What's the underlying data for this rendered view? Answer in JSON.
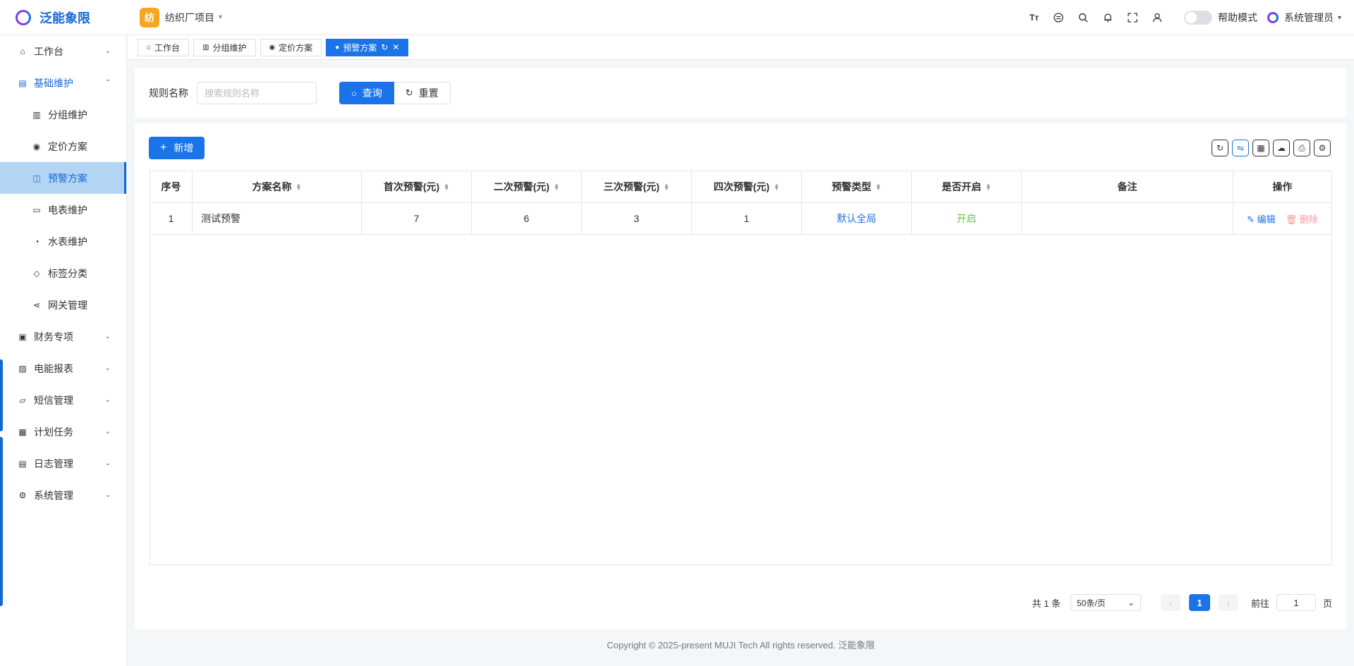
{
  "app": {
    "name": "泛能象限",
    "project_badge": "纺",
    "project_name": "纺织厂项目"
  },
  "header": {
    "font_icon_label": "Tт",
    "help_label": "帮助模式",
    "user_name": "系统管理员"
  },
  "sidebar": {
    "items": [
      {
        "label": "工作台"
      },
      {
        "label": "基础维护"
      },
      {
        "label": "分组维护"
      },
      {
        "label": "定价方案"
      },
      {
        "label": "预警方案"
      },
      {
        "label": "电表维护"
      },
      {
        "label": "水表维护"
      },
      {
        "label": "标签分类"
      },
      {
        "label": "网关管理"
      },
      {
        "label": "财务专项"
      },
      {
        "label": "电能报表"
      },
      {
        "label": "短信管理"
      },
      {
        "label": "计划任务"
      },
      {
        "label": "日志管理"
      },
      {
        "label": "系统管理"
      }
    ]
  },
  "tabs": [
    {
      "label": "工作台"
    },
    {
      "label": "分组维护"
    },
    {
      "label": "定价方案"
    },
    {
      "label": "预警方案"
    }
  ],
  "search": {
    "label": "规则名称",
    "placeholder": "搜索规则名称",
    "query_label": "查询",
    "reset_label": "重置"
  },
  "toolbar": {
    "add_label": "新增"
  },
  "table": {
    "columns": [
      "序号",
      "方案名称",
      "首次预警(元)",
      "二次预警(元)",
      "三次预警(元)",
      "四次预警(元)",
      "预警类型",
      "是否开启",
      "备注",
      "操作"
    ],
    "rows": [
      {
        "index": "1",
        "name": "测试预警",
        "first": "7",
        "second": "6",
        "third": "3",
        "fourth": "1",
        "type": "默认全局",
        "enabled": "开启",
        "remark": "",
        "edit": "编辑",
        "delete": "删除"
      }
    ]
  },
  "pagination": {
    "total": "共 1 条",
    "page_size": "50条/页",
    "current_page": "1",
    "goto_label": "前往",
    "goto_value": "1",
    "page_unit": "页"
  },
  "footer": {
    "copyright": "Copyright © 2025-present MUJI Tech All rights reserved. 泛能象限"
  },
  "colors": {
    "primary": "#1a73e8",
    "active_menu_bg": "#b3d4f3",
    "success": "#67c23a",
    "danger_light": "#f89898",
    "project_badge": "#f5a623"
  }
}
